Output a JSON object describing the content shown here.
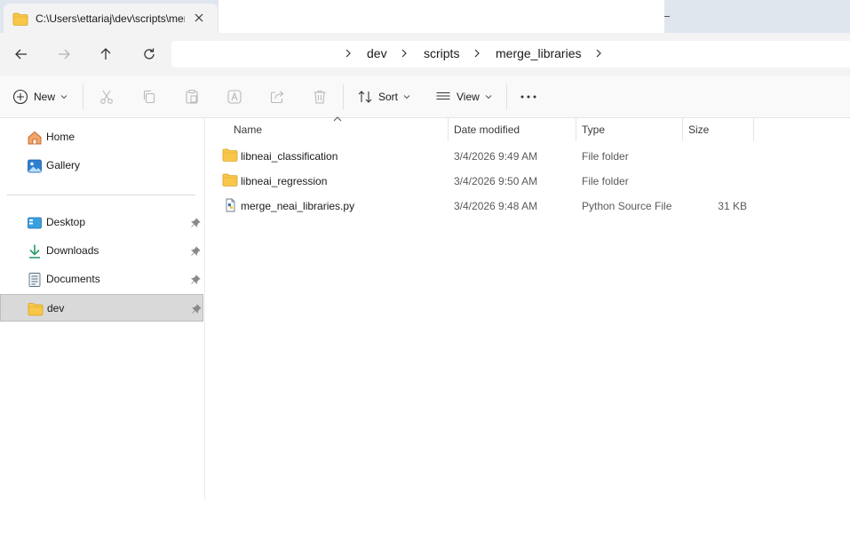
{
  "window": {
    "tab_title": "C:\\Users\\ettariaj\\dev\\scripts\\merge_libraries"
  },
  "nav": {
    "breadcrumbs": [
      "dev",
      "scripts",
      "merge_libraries"
    ]
  },
  "commands": {
    "new": "New",
    "sort": "Sort",
    "view": "View"
  },
  "sidebar": {
    "items": [
      {
        "label": "Home",
        "icon": "home-icon"
      },
      {
        "label": "Gallery",
        "icon": "gallery-icon"
      },
      {
        "label": "Desktop",
        "icon": "desktop-icon"
      },
      {
        "label": "Downloads",
        "icon": "downloads-icon"
      },
      {
        "label": "Documents",
        "icon": "documents-icon"
      },
      {
        "label": "dev",
        "icon": "folder-icon"
      }
    ]
  },
  "columns": {
    "name": "Name",
    "date": "Date modified",
    "type": "Type",
    "size": "Size"
  },
  "files": [
    {
      "name": "libneai_classification",
      "date": "3/4/2026 9:49 AM",
      "type": "File folder",
      "size": ""
    },
    {
      "name": "libneai_regression",
      "date": "3/4/2026 9:50 AM",
      "type": "File folder",
      "size": ""
    },
    {
      "name": "merge_neai_libraries.py",
      "date": "3/4/2026 9:48 AM",
      "type": "Python Source File",
      "size": "31 KB"
    }
  ],
  "colors": {
    "folder": "#f8c74a",
    "accent": "#0067c0",
    "selected": "#d9d9d9"
  }
}
